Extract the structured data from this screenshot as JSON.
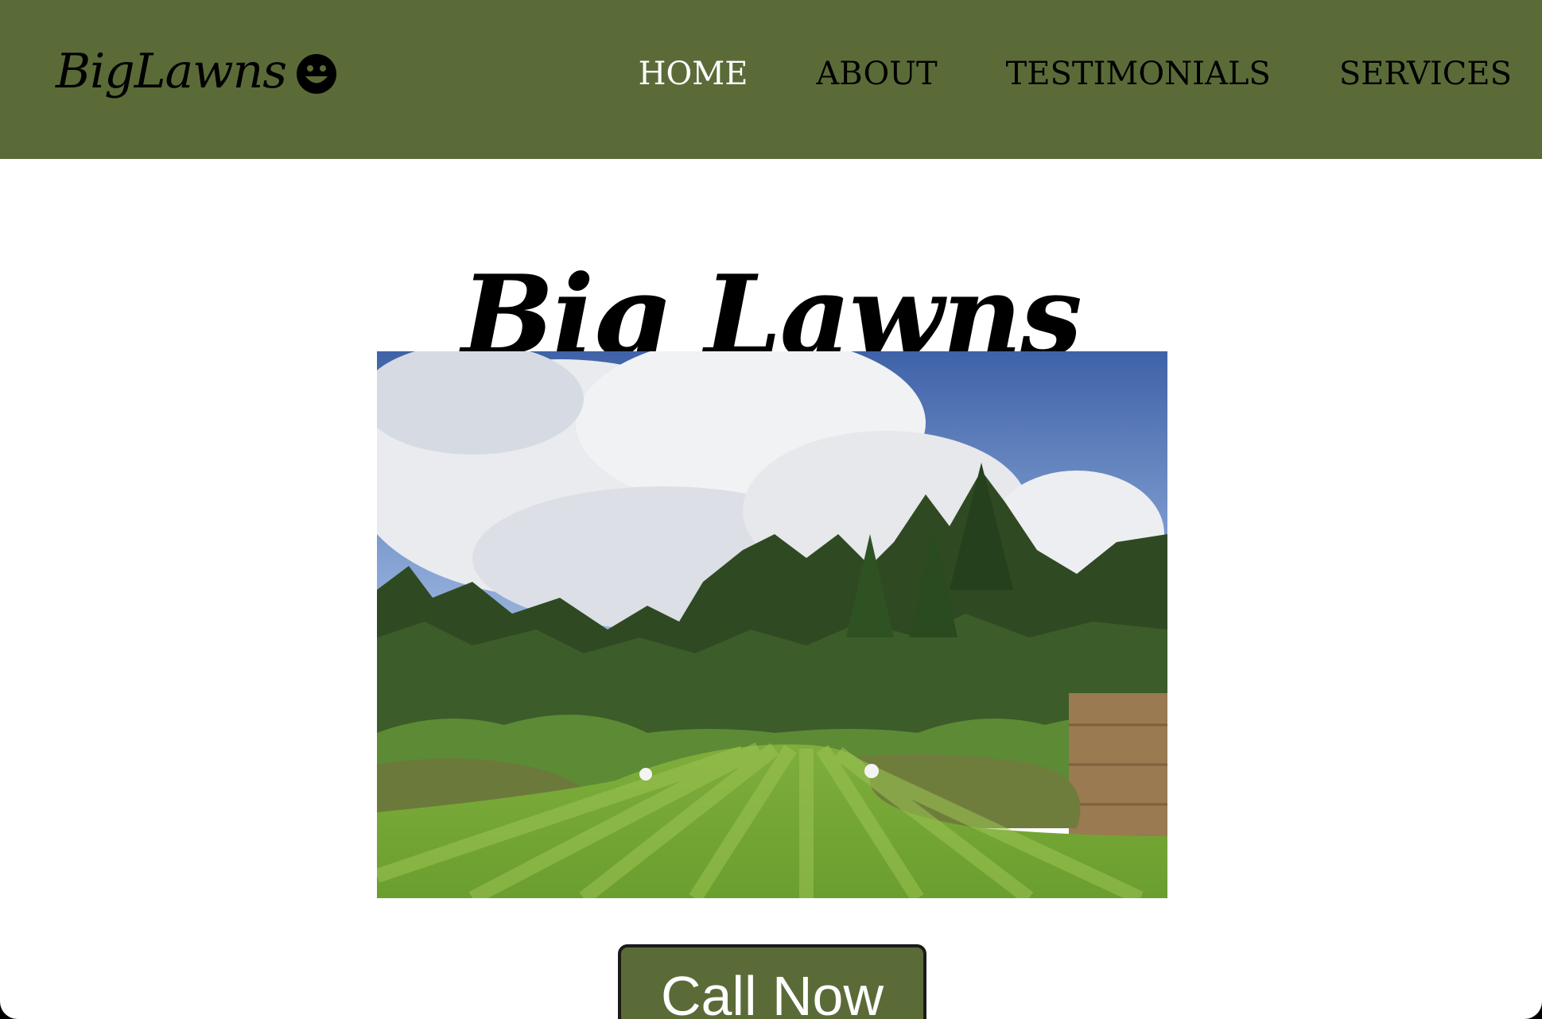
{
  "brand": {
    "name": "BigLawns",
    "icon": "smiley-face-icon"
  },
  "nav": {
    "items": [
      {
        "label": "HOME",
        "active": true
      },
      {
        "label": "ABOUT",
        "active": false
      },
      {
        "label": "TESTIMONIALS",
        "active": false
      },
      {
        "label": "SERVICES",
        "active": false
      }
    ]
  },
  "hero": {
    "title": "Big Lawns",
    "image": "striped-lawn-garden-photo"
  },
  "cta": {
    "label": "Call Now"
  },
  "colors": {
    "nav_background": "#5b6b38",
    "button_background": "#5b6b38",
    "active_link": "#ffffff",
    "text": "#000000"
  }
}
